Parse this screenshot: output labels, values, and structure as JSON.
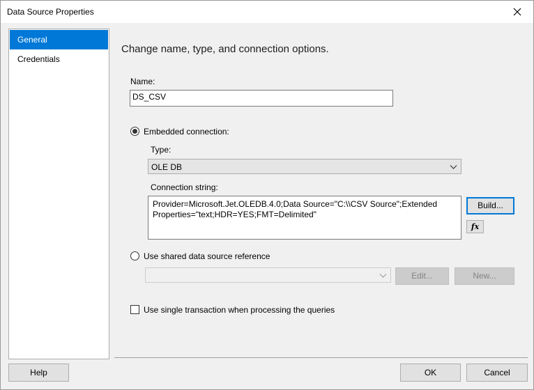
{
  "window": {
    "title": "Data Source Properties"
  },
  "sidebar": {
    "items": [
      {
        "label": "General"
      },
      {
        "label": "Credentials"
      }
    ]
  },
  "main": {
    "heading": "Change name, type, and connection options.",
    "name_label": "Name:",
    "name_value": "DS_CSV",
    "embedded_label": "Embedded connection:",
    "type_label": "Type:",
    "type_value": "OLE DB",
    "connstr_label": "Connection string:",
    "connstr_value": "Provider=Microsoft.Jet.OLEDB.4.0;Data Source=\"C:\\\\CSV Source\";Extended Properties=\"text;HDR=YES;FMT=Delimited\"",
    "build_label": "Build...",
    "fx_label": "fx",
    "shared_label": "Use shared data source reference",
    "shared_value": "",
    "edit_label": "Edit...",
    "new_label": "New...",
    "single_tx_label": "Use single transaction when processing the queries"
  },
  "footer": {
    "help_label": "Help",
    "ok_label": "OK",
    "cancel_label": "Cancel"
  },
  "state": {
    "embedded_selected": true,
    "shared_selected": false,
    "single_tx_checked": false,
    "selected_sidebar": "General"
  },
  "colors": {
    "accent": "#0078d7",
    "disabled_bg": "#cccccc"
  }
}
